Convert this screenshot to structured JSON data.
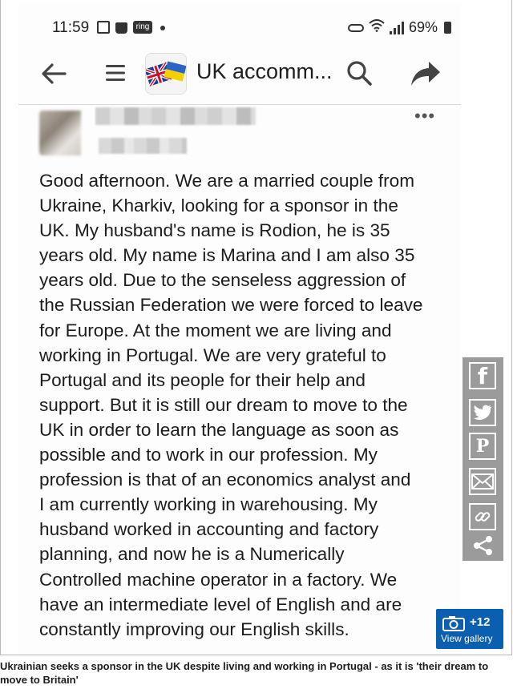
{
  "status_bar": {
    "time": "11:59",
    "ring_label": "ring",
    "battery": "69%"
  },
  "app_bar": {
    "group_title": "UK accomm...",
    "icons": [
      "back-arrow-icon",
      "hamburger-menu-icon",
      "search-icon",
      "share-arrow-icon"
    ]
  },
  "post": {
    "body": "Good afternoon. We are a married couple from\nUkraine, Kharkiv, looking for a sponsor in the\nUK. My husband's name is Rodion, he is 35\nyears old. My name is Marina and I am also 35\nyears old. Due to the senseless aggression of\nthe Russian Federation we were forced to leave\nfor Europe. At the moment we are living and\nworking in Portugal. We are very grateful to\nPortugal and its people for their help and\nsupport. But it is still our dream to move to the\nUK in order to learn the language as soon as\npossible and to work in our profession. My\nprofession is that of an economics analyst and\nI am currently working in warehousing. My\nhusband worked in accounting and factory\nplanning, and now he is a Numerically\nControlled machine operator in a factory. We\nhave an intermediate level of English and are\nconstantly improving our English skills.",
    "more": "•••"
  },
  "share_bar": {
    "facebook": "f",
    "pinterest": "P"
  },
  "gallery": {
    "count": "+12",
    "label": "View gallery"
  },
  "caption": "Ukrainian seeks a sponsor in the UK despite living and working in Portugal - as it is 'their dream to move to Britain'",
  "colors": {
    "gallery_button": "#0b5fb0",
    "share_bar": "#9b9b9b"
  }
}
